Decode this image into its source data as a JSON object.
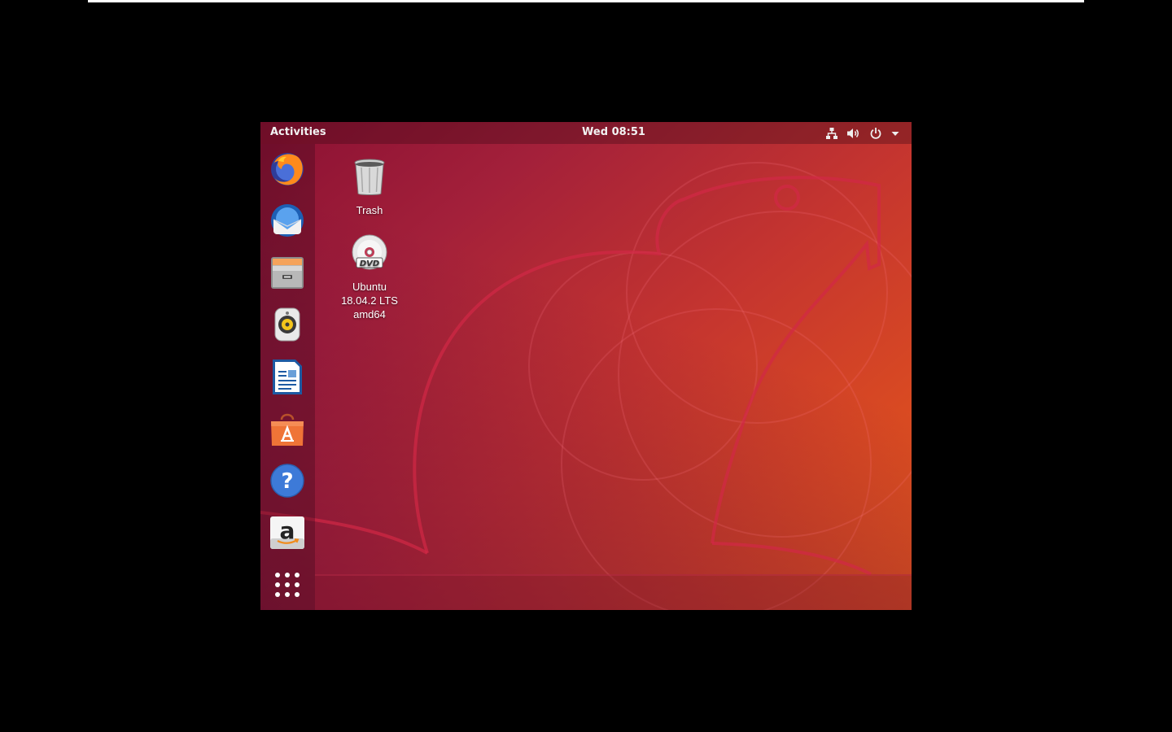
{
  "topbar": {
    "activities_label": "Activities",
    "clock": "Wed 08:51",
    "tray_icons": [
      "network-icon",
      "volume-icon",
      "power-icon",
      "chevron-down-icon"
    ]
  },
  "dock": {
    "items": [
      {
        "name": "Firefox",
        "icon": "firefox-icon"
      },
      {
        "name": "Thunderbird",
        "icon": "thunderbird-icon"
      },
      {
        "name": "Files",
        "icon": "files-icon"
      },
      {
        "name": "Rhythmbox",
        "icon": "rhythmbox-icon"
      },
      {
        "name": "LibreOffice Writer",
        "icon": "writer-icon"
      },
      {
        "name": "Ubuntu Software",
        "icon": "software-icon"
      },
      {
        "name": "Help",
        "icon": "help-icon"
      },
      {
        "name": "Amazon",
        "icon": "amazon-icon"
      },
      {
        "name": "Show Applications",
        "icon": "app-grid-icon"
      }
    ]
  },
  "desktop": {
    "icons": [
      {
        "label": "Trash",
        "icon": "trash-icon"
      },
      {
        "label": "Ubuntu\n18.04.2 LTS\namd64",
        "icon": "dvd-icon"
      }
    ]
  },
  "colors": {
    "wallpaper_start": "#8a1033",
    "wallpaper_end": "#e55a1a",
    "panel_text": "#f2f2f2"
  }
}
